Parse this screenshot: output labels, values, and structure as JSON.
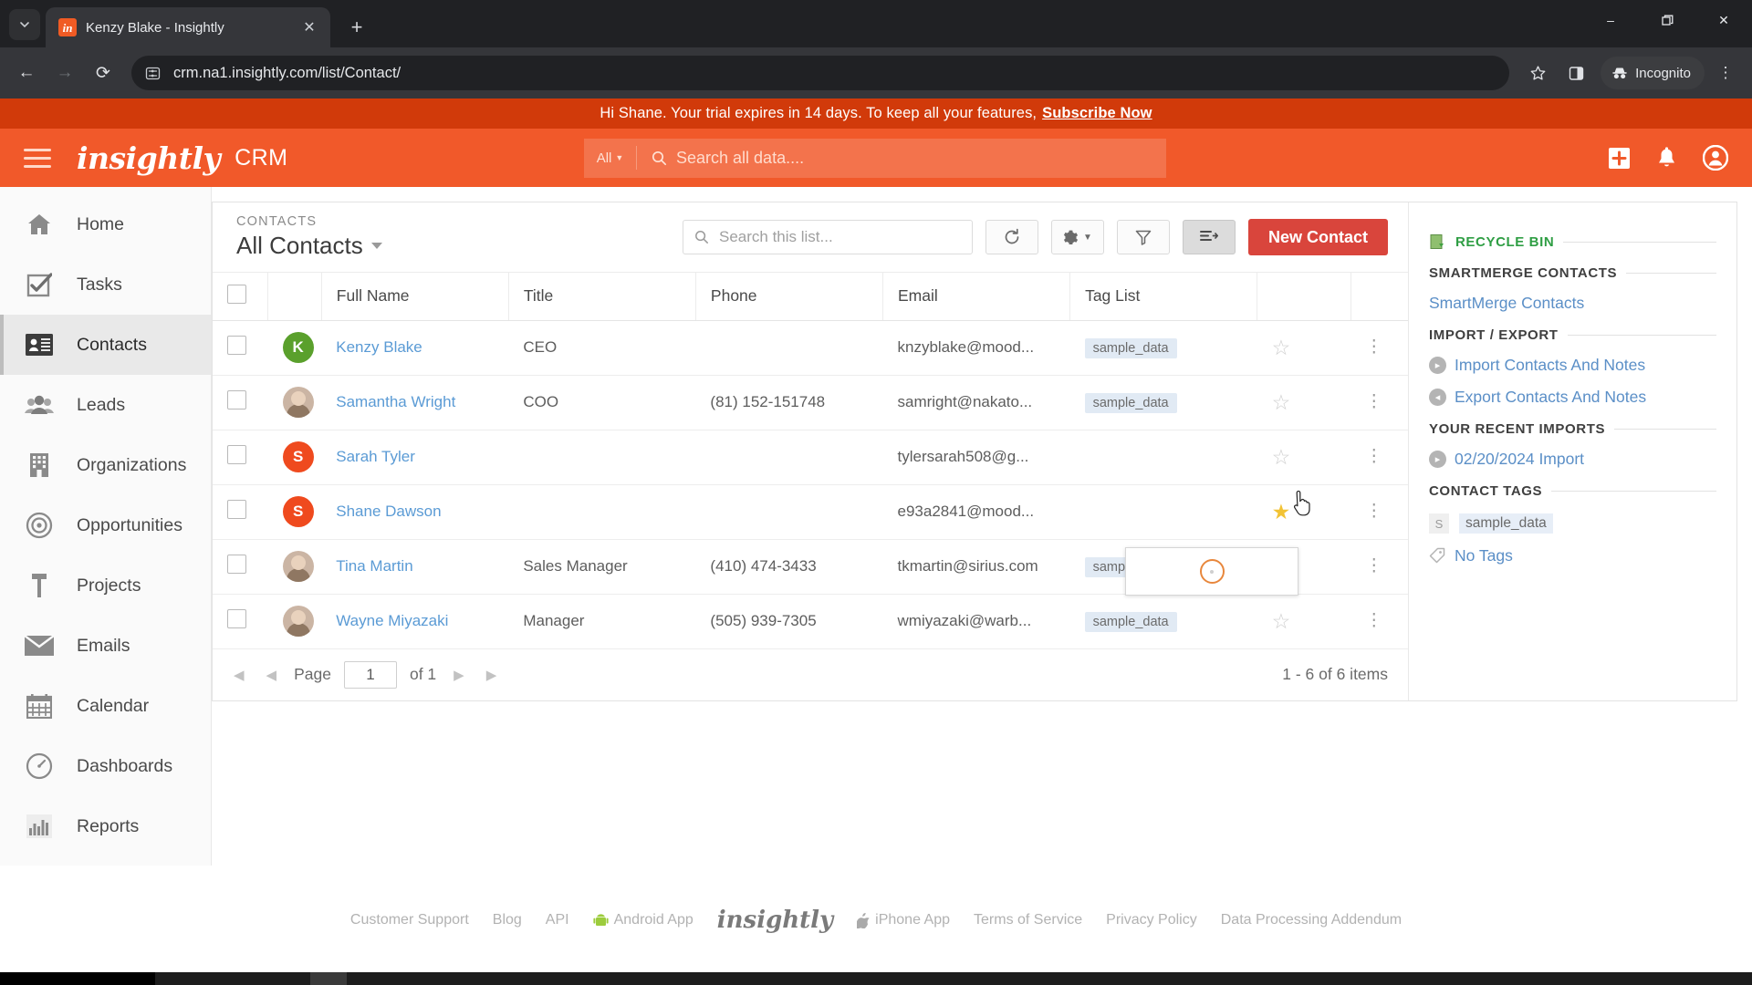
{
  "browser": {
    "tab": {
      "title": "Kenzy Blake - Insightly",
      "favicon_letters": "in",
      "close_icon": "close-icon"
    },
    "new_tab_label": "+",
    "window_controls": {
      "minimize": "–",
      "maximize": "❐",
      "close": "✕"
    },
    "url": "crm.na1.insightly.com/list/Contact/",
    "incognito_label": "Incognito",
    "nav": {
      "back": "←",
      "forward": "→",
      "reload": "⟳"
    }
  },
  "banner": {
    "text": "Hi Shane. Your trial expires in 14 days. To keep all your features,",
    "cta": "Subscribe Now",
    "bg_color": "#d13a0a"
  },
  "header": {
    "brand": "insightly",
    "product": "CRM",
    "search_scope": "All",
    "search_placeholder": "Search all data....",
    "bg_color": "#f1592a",
    "icons": {
      "add": "plus-icon",
      "notifications": "bell-icon",
      "profile": "user-icon"
    }
  },
  "sidebar": {
    "items": [
      {
        "label": "Home",
        "icon": "home-icon",
        "active": false
      },
      {
        "label": "Tasks",
        "icon": "task-check-icon",
        "active": false
      },
      {
        "label": "Contacts",
        "icon": "contact-card-icon",
        "active": true
      },
      {
        "label": "Leads",
        "icon": "people-icon",
        "active": false
      },
      {
        "label": "Organizations",
        "icon": "building-icon",
        "active": false
      },
      {
        "label": "Opportunities",
        "icon": "target-icon",
        "active": false
      },
      {
        "label": "Projects",
        "icon": "hammer-icon",
        "active": false
      },
      {
        "label": "Emails",
        "icon": "envelope-icon",
        "active": false
      },
      {
        "label": "Calendar",
        "icon": "calendar-icon",
        "active": false
      },
      {
        "label": "Dashboards",
        "icon": "gauge-icon",
        "active": false
      },
      {
        "label": "Reports",
        "icon": "bar-chart-icon",
        "active": false
      }
    ]
  },
  "list_header": {
    "breadcrumb": "CONTACTS",
    "view_name": "All Contacts",
    "search_placeholder": "Search this list...",
    "refresh_icon": "refresh-icon",
    "settings_icon": "gear-icon",
    "filter_icon": "funnel-icon",
    "sort_icon": "sort-icon",
    "new_button": "New Contact",
    "new_button_color": "#d9453c"
  },
  "table": {
    "columns": [
      "Full Name",
      "Title",
      "Phone",
      "Email",
      "Tag List"
    ],
    "rows": [
      {
        "name": "Kenzy Blake",
        "title": "CEO",
        "phone": "",
        "email": "knzyblake@mood...",
        "tag": "sample_data",
        "starred": false,
        "avatar_type": "initial",
        "initial": "K",
        "avatar_color": "#5aa02c"
      },
      {
        "name": "Samantha Wright",
        "title": "COO",
        "phone": "(81) 152-151748",
        "email": "samright@nakato...",
        "tag": "sample_data",
        "starred": false,
        "avatar_type": "photo",
        "initial": "",
        "avatar_color": "#cbb5a4"
      },
      {
        "name": "Sarah Tyler",
        "title": "",
        "phone": "",
        "email": "tylersarah508@g...",
        "tag": "",
        "starred": false,
        "avatar_type": "initial",
        "initial": "S",
        "avatar_color": "#ef4a1e"
      },
      {
        "name": "Shane Dawson",
        "title": "",
        "phone": "",
        "email": "e93a2841@mood...",
        "tag": "",
        "starred": true,
        "avatar_type": "initial",
        "initial": "S",
        "avatar_color": "#ef4a1e"
      },
      {
        "name": "Tina Martin",
        "title": "Sales Manager",
        "phone": "(410) 474-3433",
        "email": "tkmartin@sirius.com",
        "tag": "sample_data",
        "starred": false,
        "avatar_type": "photo",
        "initial": "",
        "avatar_color": "#cbb5a4"
      },
      {
        "name": "Wayne Miyazaki",
        "title": "Manager",
        "phone": "(505) 939-7305",
        "email": "wmiyazaki@warb...",
        "tag": "sample_data",
        "starred": false,
        "avatar_type": "photo",
        "initial": "",
        "avatar_color": "#b79b84"
      }
    ]
  },
  "pager": {
    "page_label": "Page",
    "page_value": "1",
    "of_label": "of 1",
    "items_summary": "1 - 6 of 6 items"
  },
  "side_panel": {
    "recycle_bin": "RECYCLE BIN",
    "smartmerge_heading": "SMARTMERGE CONTACTS",
    "smartmerge_link": "SmartMerge Contacts",
    "import_export_heading": "IMPORT / EXPORT",
    "import_link": "Import Contacts And Notes",
    "export_link": "Export Contacts And Notes",
    "recent_imports_heading": "YOUR RECENT IMPORTS",
    "recent_import_link": "02/20/2024 Import",
    "contact_tags_heading": "CONTACT TAGS",
    "tag_initial": "S",
    "tag_name": "sample_data",
    "no_tags": "No Tags"
  },
  "footer": {
    "links": [
      "Customer Support",
      "Blog",
      "API"
    ],
    "android": "Android App",
    "brand": "insightly",
    "iphone": "iPhone App",
    "links2": [
      "Terms of Service",
      "Privacy Policy",
      "Data Processing Addendum"
    ]
  }
}
